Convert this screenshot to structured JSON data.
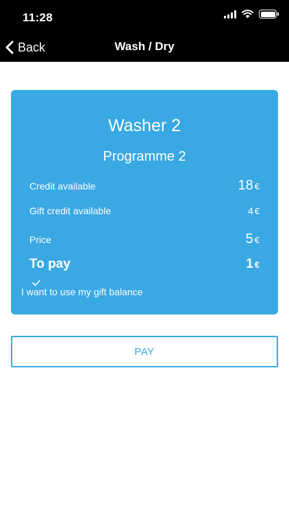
{
  "status_bar": {
    "time": "11:28"
  },
  "nav": {
    "back_label": "Back",
    "title": "Wash / Dry"
  },
  "card": {
    "machine": "Washer 2",
    "programme": "Programme 2",
    "rows": [
      {
        "label": "Credit available",
        "amount": "18",
        "currency": "€"
      },
      {
        "label": "Gift credit available",
        "amount": "4",
        "currency": "€"
      },
      {
        "label": "Price",
        "amount": "5",
        "currency": "€"
      },
      {
        "label": "To pay",
        "amount": "1",
        "currency": "€"
      }
    ],
    "gift_option": {
      "label": "I want to use my gift balance",
      "checked": true
    }
  },
  "pay_button": {
    "label": "PAY"
  },
  "colors": {
    "accent": "#39a8e3",
    "bar": "#000000",
    "background": "#ffffff"
  }
}
